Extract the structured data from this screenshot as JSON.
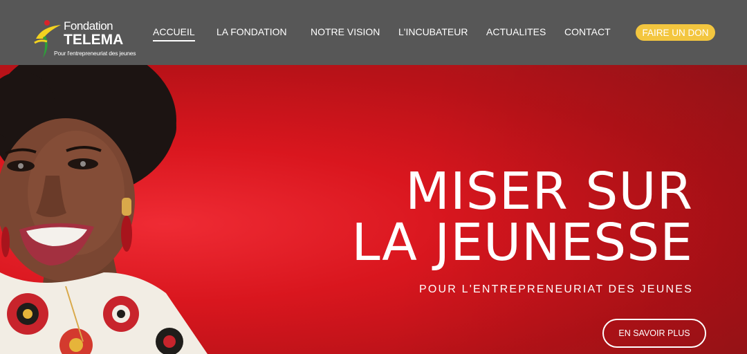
{
  "brand": {
    "name_line1": "Fondation",
    "name_line2": "TELEMA",
    "tagline": "Pour l'entrepreneuriat des jeunes",
    "colors": {
      "green": "#2e9e3a",
      "yellow": "#f3d21f",
      "red": "#d8232a"
    }
  },
  "nav": {
    "items": [
      {
        "label": "ACCUEIL",
        "active": true
      },
      {
        "label": "LA FONDATION",
        "active": false
      },
      {
        "label": "NOTRE VISION",
        "active": false
      },
      {
        "label": "L'INCUBATEUR",
        "active": false
      },
      {
        "label": "ACTUALITES",
        "active": false
      },
      {
        "label": "CONTACT",
        "active": false
      }
    ],
    "donate_label": "FAIRE UN DON"
  },
  "hero": {
    "title_line1": "MISER SUR",
    "title_line2": "LA JEUNESSE",
    "subtitle": "POUR L'ENTREPRENEURIAT DES JEUNES",
    "cta_label": "EN SAVOIR PLUS"
  },
  "colors": {
    "header_bg": "#575757",
    "hero_red": "#d9161e",
    "donate_yellow": "#f3c63f"
  }
}
